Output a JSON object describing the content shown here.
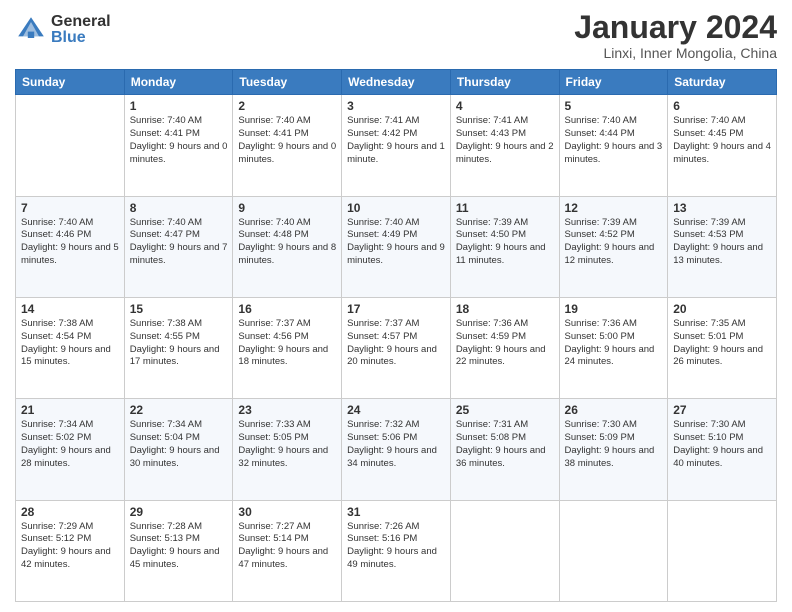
{
  "header": {
    "logo_general": "General",
    "logo_blue": "Blue",
    "month_title": "January 2024",
    "location": "Linxi, Inner Mongolia, China"
  },
  "weekdays": [
    "Sunday",
    "Monday",
    "Tuesday",
    "Wednesday",
    "Thursday",
    "Friday",
    "Saturday"
  ],
  "weeks": [
    [
      {
        "day": "",
        "sunrise": "",
        "sunset": "",
        "daylight": ""
      },
      {
        "day": "1",
        "sunrise": "Sunrise: 7:40 AM",
        "sunset": "Sunset: 4:41 PM",
        "daylight": "Daylight: 9 hours and 0 minutes."
      },
      {
        "day": "2",
        "sunrise": "Sunrise: 7:40 AM",
        "sunset": "Sunset: 4:41 PM",
        "daylight": "Daylight: 9 hours and 0 minutes."
      },
      {
        "day": "3",
        "sunrise": "Sunrise: 7:41 AM",
        "sunset": "Sunset: 4:42 PM",
        "daylight": "Daylight: 9 hours and 1 minute."
      },
      {
        "day": "4",
        "sunrise": "Sunrise: 7:41 AM",
        "sunset": "Sunset: 4:43 PM",
        "daylight": "Daylight: 9 hours and 2 minutes."
      },
      {
        "day": "5",
        "sunrise": "Sunrise: 7:40 AM",
        "sunset": "Sunset: 4:44 PM",
        "daylight": "Daylight: 9 hours and 3 minutes."
      },
      {
        "day": "6",
        "sunrise": "Sunrise: 7:40 AM",
        "sunset": "Sunset: 4:45 PM",
        "daylight": "Daylight: 9 hours and 4 minutes."
      }
    ],
    [
      {
        "day": "7",
        "sunrise": "Sunrise: 7:40 AM",
        "sunset": "Sunset: 4:46 PM",
        "daylight": "Daylight: 9 hours and 5 minutes."
      },
      {
        "day": "8",
        "sunrise": "Sunrise: 7:40 AM",
        "sunset": "Sunset: 4:47 PM",
        "daylight": "Daylight: 9 hours and 7 minutes."
      },
      {
        "day": "9",
        "sunrise": "Sunrise: 7:40 AM",
        "sunset": "Sunset: 4:48 PM",
        "daylight": "Daylight: 9 hours and 8 minutes."
      },
      {
        "day": "10",
        "sunrise": "Sunrise: 7:40 AM",
        "sunset": "Sunset: 4:49 PM",
        "daylight": "Daylight: 9 hours and 9 minutes."
      },
      {
        "day": "11",
        "sunrise": "Sunrise: 7:39 AM",
        "sunset": "Sunset: 4:50 PM",
        "daylight": "Daylight: 9 hours and 11 minutes."
      },
      {
        "day": "12",
        "sunrise": "Sunrise: 7:39 AM",
        "sunset": "Sunset: 4:52 PM",
        "daylight": "Daylight: 9 hours and 12 minutes."
      },
      {
        "day": "13",
        "sunrise": "Sunrise: 7:39 AM",
        "sunset": "Sunset: 4:53 PM",
        "daylight": "Daylight: 9 hours and 13 minutes."
      }
    ],
    [
      {
        "day": "14",
        "sunrise": "Sunrise: 7:38 AM",
        "sunset": "Sunset: 4:54 PM",
        "daylight": "Daylight: 9 hours and 15 minutes."
      },
      {
        "day": "15",
        "sunrise": "Sunrise: 7:38 AM",
        "sunset": "Sunset: 4:55 PM",
        "daylight": "Daylight: 9 hours and 17 minutes."
      },
      {
        "day": "16",
        "sunrise": "Sunrise: 7:37 AM",
        "sunset": "Sunset: 4:56 PM",
        "daylight": "Daylight: 9 hours and 18 minutes."
      },
      {
        "day": "17",
        "sunrise": "Sunrise: 7:37 AM",
        "sunset": "Sunset: 4:57 PM",
        "daylight": "Daylight: 9 hours and 20 minutes."
      },
      {
        "day": "18",
        "sunrise": "Sunrise: 7:36 AM",
        "sunset": "Sunset: 4:59 PM",
        "daylight": "Daylight: 9 hours and 22 minutes."
      },
      {
        "day": "19",
        "sunrise": "Sunrise: 7:36 AM",
        "sunset": "Sunset: 5:00 PM",
        "daylight": "Daylight: 9 hours and 24 minutes."
      },
      {
        "day": "20",
        "sunrise": "Sunrise: 7:35 AM",
        "sunset": "Sunset: 5:01 PM",
        "daylight": "Daylight: 9 hours and 26 minutes."
      }
    ],
    [
      {
        "day": "21",
        "sunrise": "Sunrise: 7:34 AM",
        "sunset": "Sunset: 5:02 PM",
        "daylight": "Daylight: 9 hours and 28 minutes."
      },
      {
        "day": "22",
        "sunrise": "Sunrise: 7:34 AM",
        "sunset": "Sunset: 5:04 PM",
        "daylight": "Daylight: 9 hours and 30 minutes."
      },
      {
        "day": "23",
        "sunrise": "Sunrise: 7:33 AM",
        "sunset": "Sunset: 5:05 PM",
        "daylight": "Daylight: 9 hours and 32 minutes."
      },
      {
        "day": "24",
        "sunrise": "Sunrise: 7:32 AM",
        "sunset": "Sunset: 5:06 PM",
        "daylight": "Daylight: 9 hours and 34 minutes."
      },
      {
        "day": "25",
        "sunrise": "Sunrise: 7:31 AM",
        "sunset": "Sunset: 5:08 PM",
        "daylight": "Daylight: 9 hours and 36 minutes."
      },
      {
        "day": "26",
        "sunrise": "Sunrise: 7:30 AM",
        "sunset": "Sunset: 5:09 PM",
        "daylight": "Daylight: 9 hours and 38 minutes."
      },
      {
        "day": "27",
        "sunrise": "Sunrise: 7:30 AM",
        "sunset": "Sunset: 5:10 PM",
        "daylight": "Daylight: 9 hours and 40 minutes."
      }
    ],
    [
      {
        "day": "28",
        "sunrise": "Sunrise: 7:29 AM",
        "sunset": "Sunset: 5:12 PM",
        "daylight": "Daylight: 9 hours and 42 minutes."
      },
      {
        "day": "29",
        "sunrise": "Sunrise: 7:28 AM",
        "sunset": "Sunset: 5:13 PM",
        "daylight": "Daylight: 9 hours and 45 minutes."
      },
      {
        "day": "30",
        "sunrise": "Sunrise: 7:27 AM",
        "sunset": "Sunset: 5:14 PM",
        "daylight": "Daylight: 9 hours and 47 minutes."
      },
      {
        "day": "31",
        "sunrise": "Sunrise: 7:26 AM",
        "sunset": "Sunset: 5:16 PM",
        "daylight": "Daylight: 9 hours and 49 minutes."
      },
      {
        "day": "",
        "sunrise": "",
        "sunset": "",
        "daylight": ""
      },
      {
        "day": "",
        "sunrise": "",
        "sunset": "",
        "daylight": ""
      },
      {
        "day": "",
        "sunrise": "",
        "sunset": "",
        "daylight": ""
      }
    ]
  ]
}
